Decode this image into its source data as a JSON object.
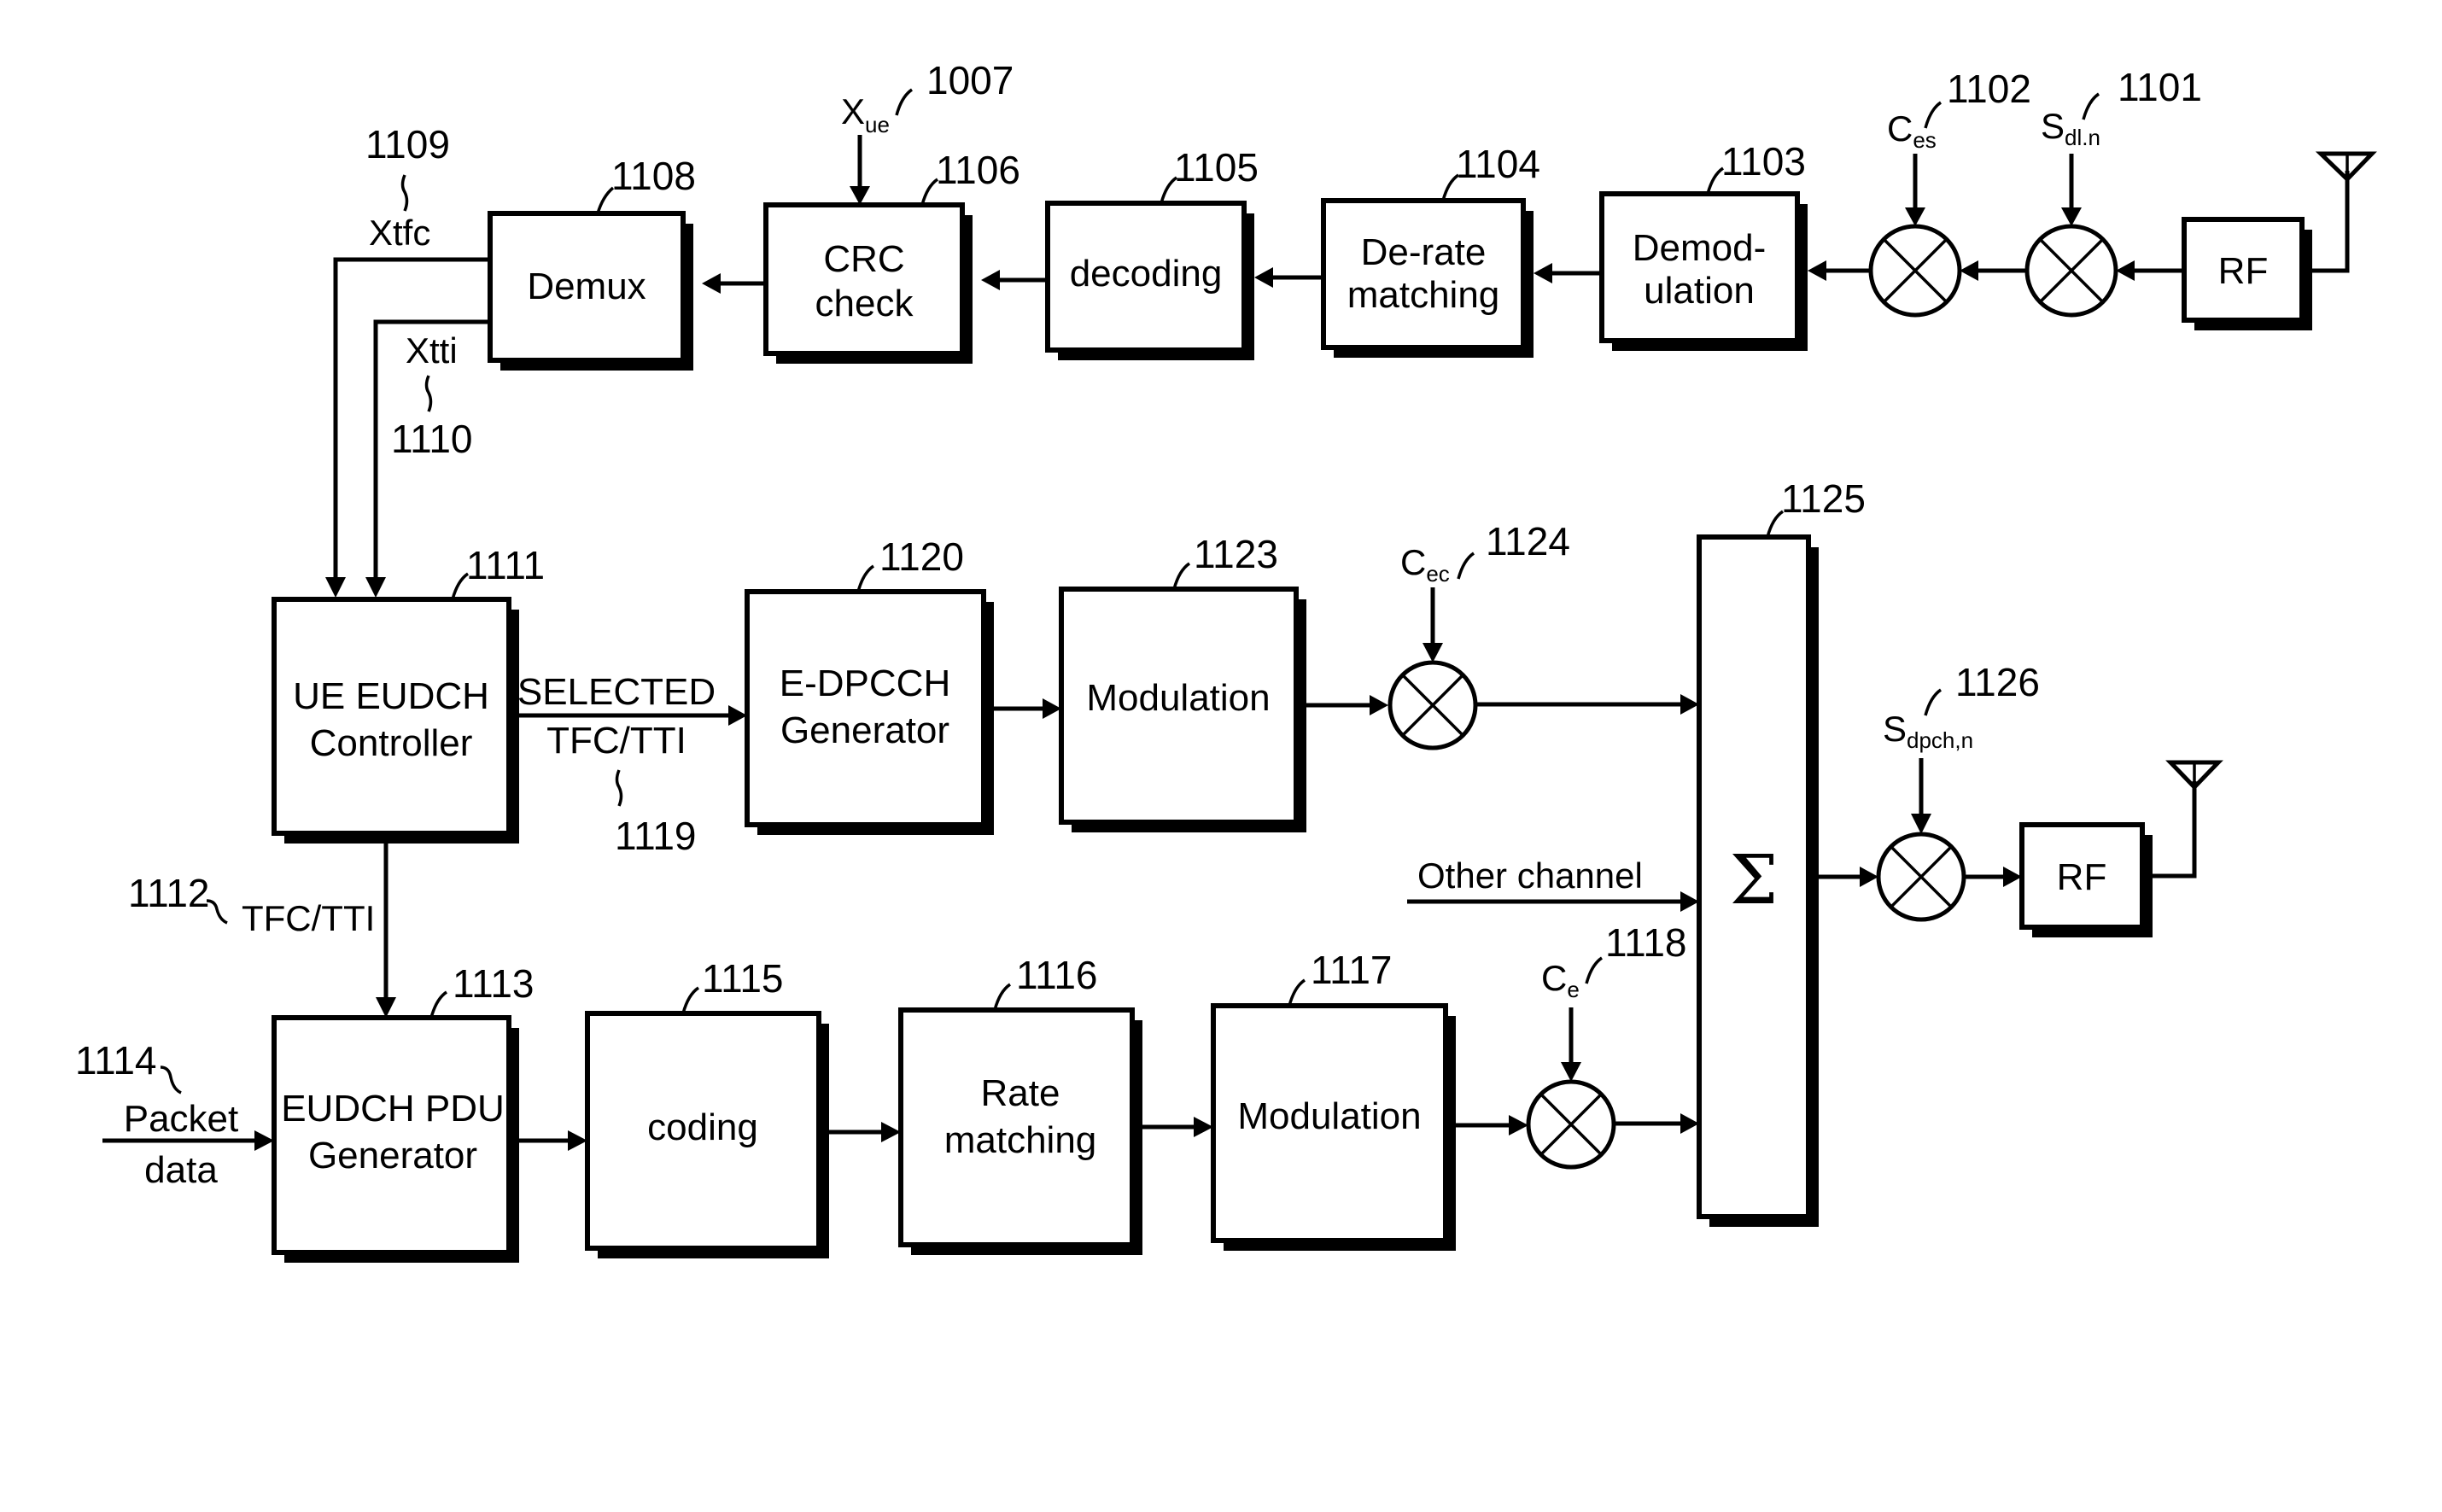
{
  "diagram": {
    "colors": {
      "line": "#000000",
      "background": "#ffffff"
    },
    "receiver_chain": {
      "blocks": [
        {
          "id": "1108",
          "lines": [
            "Demux"
          ]
        },
        {
          "id": "1106",
          "lines": [
            "CRC",
            "check"
          ]
        },
        {
          "id": "1105",
          "lines": [
            "decoding"
          ]
        },
        {
          "id": "1104",
          "lines": [
            "De-rate",
            "matching"
          ]
        },
        {
          "id": "1103",
          "lines": [
            "Demod-",
            "ulation"
          ]
        },
        {
          "id": "rf_rx",
          "lines": [
            "RF"
          ]
        }
      ],
      "mixers": [
        {
          "id": "1102",
          "code_main": "C",
          "code_sub": "es"
        },
        {
          "id": "1101",
          "code_main": "S",
          "code_sub": "dl.n"
        }
      ],
      "crc_input": {
        "id": "1007",
        "main": "X",
        "sub": "ue"
      },
      "outputs": [
        {
          "id": "1109",
          "label": "Xtfc"
        },
        {
          "id": "1110",
          "label": "Xtti"
        }
      ]
    },
    "control": {
      "controller": {
        "id": "1111",
        "lines": [
          "UE EUDCH",
          "Controller"
        ]
      },
      "selected_signal": {
        "id": "1119",
        "lines": [
          "SELECTED",
          "TFC/TTI"
        ]
      },
      "tfc_tti_signal": {
        "id": "1112",
        "label": "TFC/TTI"
      }
    },
    "edpcch_chain": {
      "blocks": [
        {
          "id": "1120",
          "lines": [
            "E-DPCCH",
            "Generator"
          ]
        },
        {
          "id": "1123",
          "lines": [
            "Modulation"
          ]
        }
      ],
      "mixer": {
        "id": "1124",
        "code_main": "C",
        "code_sub": "ec"
      }
    },
    "eudch_chain": {
      "input": {
        "id": "1114",
        "lines": [
          "Packet",
          "data"
        ]
      },
      "blocks": [
        {
          "id": "1113",
          "lines": [
            "EUDCH PDU",
            "Generator"
          ]
        },
        {
          "id": "1115",
          "lines": [
            "coding"
          ]
        },
        {
          "id": "1116",
          "lines": [
            "Rate",
            "matching"
          ]
        },
        {
          "id": "1117",
          "lines": [
            "Modulation"
          ]
        }
      ],
      "mixer": {
        "id": "1118",
        "code_main": "C",
        "code_sub": "e"
      }
    },
    "summer": {
      "id": "1125",
      "symbol": "Σ",
      "other_input": "Other channel"
    },
    "tx_output": {
      "mixer": {
        "id": "1126",
        "code_main": "S",
        "code_sub": "dpch,n"
      },
      "rf": {
        "lines": [
          "RF"
        ]
      }
    }
  }
}
